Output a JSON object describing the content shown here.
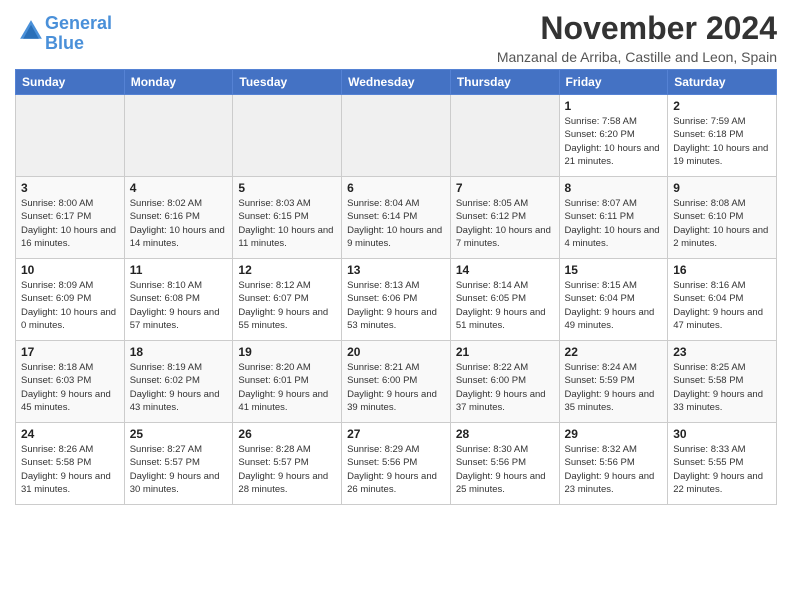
{
  "logo": {
    "line1": "General",
    "line2": "Blue"
  },
  "title": "November 2024",
  "subtitle": "Manzanal de Arriba, Castille and Leon, Spain",
  "weekdays": [
    "Sunday",
    "Monday",
    "Tuesday",
    "Wednesday",
    "Thursday",
    "Friday",
    "Saturday"
  ],
  "weeks": [
    [
      {
        "day": "",
        "info": ""
      },
      {
        "day": "",
        "info": ""
      },
      {
        "day": "",
        "info": ""
      },
      {
        "day": "",
        "info": ""
      },
      {
        "day": "",
        "info": ""
      },
      {
        "day": "1",
        "info": "Sunrise: 7:58 AM\nSunset: 6:20 PM\nDaylight: 10 hours and 21 minutes."
      },
      {
        "day": "2",
        "info": "Sunrise: 7:59 AM\nSunset: 6:18 PM\nDaylight: 10 hours and 19 minutes."
      }
    ],
    [
      {
        "day": "3",
        "info": "Sunrise: 8:00 AM\nSunset: 6:17 PM\nDaylight: 10 hours and 16 minutes."
      },
      {
        "day": "4",
        "info": "Sunrise: 8:02 AM\nSunset: 6:16 PM\nDaylight: 10 hours and 14 minutes."
      },
      {
        "day": "5",
        "info": "Sunrise: 8:03 AM\nSunset: 6:15 PM\nDaylight: 10 hours and 11 minutes."
      },
      {
        "day": "6",
        "info": "Sunrise: 8:04 AM\nSunset: 6:14 PM\nDaylight: 10 hours and 9 minutes."
      },
      {
        "day": "7",
        "info": "Sunrise: 8:05 AM\nSunset: 6:12 PM\nDaylight: 10 hours and 7 minutes."
      },
      {
        "day": "8",
        "info": "Sunrise: 8:07 AM\nSunset: 6:11 PM\nDaylight: 10 hours and 4 minutes."
      },
      {
        "day": "9",
        "info": "Sunrise: 8:08 AM\nSunset: 6:10 PM\nDaylight: 10 hours and 2 minutes."
      }
    ],
    [
      {
        "day": "10",
        "info": "Sunrise: 8:09 AM\nSunset: 6:09 PM\nDaylight: 10 hours and 0 minutes."
      },
      {
        "day": "11",
        "info": "Sunrise: 8:10 AM\nSunset: 6:08 PM\nDaylight: 9 hours and 57 minutes."
      },
      {
        "day": "12",
        "info": "Sunrise: 8:12 AM\nSunset: 6:07 PM\nDaylight: 9 hours and 55 minutes."
      },
      {
        "day": "13",
        "info": "Sunrise: 8:13 AM\nSunset: 6:06 PM\nDaylight: 9 hours and 53 minutes."
      },
      {
        "day": "14",
        "info": "Sunrise: 8:14 AM\nSunset: 6:05 PM\nDaylight: 9 hours and 51 minutes."
      },
      {
        "day": "15",
        "info": "Sunrise: 8:15 AM\nSunset: 6:04 PM\nDaylight: 9 hours and 49 minutes."
      },
      {
        "day": "16",
        "info": "Sunrise: 8:16 AM\nSunset: 6:04 PM\nDaylight: 9 hours and 47 minutes."
      }
    ],
    [
      {
        "day": "17",
        "info": "Sunrise: 8:18 AM\nSunset: 6:03 PM\nDaylight: 9 hours and 45 minutes."
      },
      {
        "day": "18",
        "info": "Sunrise: 8:19 AM\nSunset: 6:02 PM\nDaylight: 9 hours and 43 minutes."
      },
      {
        "day": "19",
        "info": "Sunrise: 8:20 AM\nSunset: 6:01 PM\nDaylight: 9 hours and 41 minutes."
      },
      {
        "day": "20",
        "info": "Sunrise: 8:21 AM\nSunset: 6:00 PM\nDaylight: 9 hours and 39 minutes."
      },
      {
        "day": "21",
        "info": "Sunrise: 8:22 AM\nSunset: 6:00 PM\nDaylight: 9 hours and 37 minutes."
      },
      {
        "day": "22",
        "info": "Sunrise: 8:24 AM\nSunset: 5:59 PM\nDaylight: 9 hours and 35 minutes."
      },
      {
        "day": "23",
        "info": "Sunrise: 8:25 AM\nSunset: 5:58 PM\nDaylight: 9 hours and 33 minutes."
      }
    ],
    [
      {
        "day": "24",
        "info": "Sunrise: 8:26 AM\nSunset: 5:58 PM\nDaylight: 9 hours and 31 minutes."
      },
      {
        "day": "25",
        "info": "Sunrise: 8:27 AM\nSunset: 5:57 PM\nDaylight: 9 hours and 30 minutes."
      },
      {
        "day": "26",
        "info": "Sunrise: 8:28 AM\nSunset: 5:57 PM\nDaylight: 9 hours and 28 minutes."
      },
      {
        "day": "27",
        "info": "Sunrise: 8:29 AM\nSunset: 5:56 PM\nDaylight: 9 hours and 26 minutes."
      },
      {
        "day": "28",
        "info": "Sunrise: 8:30 AM\nSunset: 5:56 PM\nDaylight: 9 hours and 25 minutes."
      },
      {
        "day": "29",
        "info": "Sunrise: 8:32 AM\nSunset: 5:56 PM\nDaylight: 9 hours and 23 minutes."
      },
      {
        "day": "30",
        "info": "Sunrise: 8:33 AM\nSunset: 5:55 PM\nDaylight: 9 hours and 22 minutes."
      }
    ]
  ]
}
